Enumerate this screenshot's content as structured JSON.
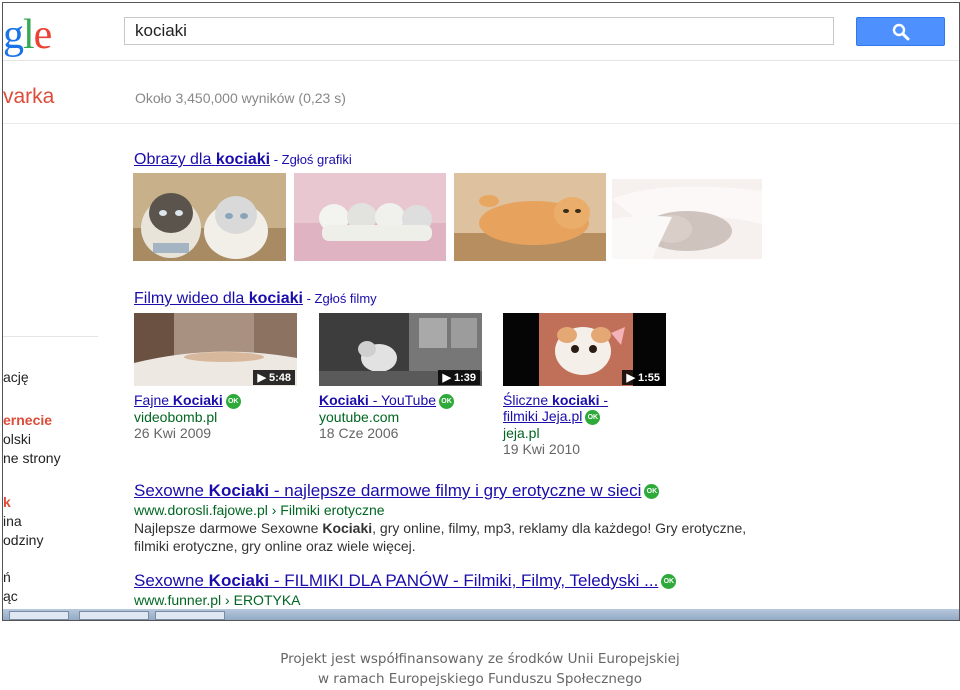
{
  "logo": {
    "visible_text": "gle",
    "colors": [
      "#1a73e8",
      "#34a853",
      "#ea4335"
    ]
  },
  "search": {
    "query": "kociaki",
    "button_icon": "magnifier-icon"
  },
  "left_title": "varka",
  "stats": "Około 3,450,000 wyników (0,23 s)",
  "sidebar": {
    "items": [
      {
        "label": "ację"
      },
      {
        "label": "ernecie"
      },
      {
        "label": "olski"
      },
      {
        "label": "ne strony"
      },
      {
        "label": "k"
      },
      {
        "label": "ina"
      },
      {
        "label": "odziny"
      },
      {
        "label": "ń"
      },
      {
        "label": "ąc"
      }
    ]
  },
  "images_section": {
    "head_prefix": "Obrazy dla ",
    "head_bold": "kociaki",
    "report_sep": " - ",
    "report": "Zgłoś grafiki"
  },
  "video_section": {
    "head_prefix": "Filmy wideo dla ",
    "head_bold": "kociaki",
    "report_sep": " - ",
    "report": "Zgłoś filmy",
    "videos": [
      {
        "duration": "▶ 5:48",
        "title_a": "Fajne ",
        "title_b": "Kociaki",
        "title_c": "",
        "title_line2": "",
        "site": "videobomb.pl",
        "date": "26 Kwi 2009",
        "ok": "OK"
      },
      {
        "duration": "▶ 1:39",
        "title_a": "",
        "title_b": "Kociaki",
        "title_c": " - YouTube",
        "title_line2": "",
        "site": "youtube.com",
        "date": "18 Cze 2006",
        "ok": "OK"
      },
      {
        "duration": "▶ 1:55",
        "title_a": "Śliczne ",
        "title_b": "kociaki",
        "title_c": " -",
        "title_line2": "filmiki Jeja.pl",
        "site": "jeja.pl",
        "date": "19 Kwi 2010",
        "ok": "OK"
      }
    ]
  },
  "results": [
    {
      "title_a": "Sexowne ",
      "title_b": "Kociaki",
      "title_c": " - najlepsze darmowe filmy i gry erotyczne w sieci",
      "ok": "OK",
      "url": "www.dorosli.fajowe.pl › Filmiki erotyczne",
      "snippet_a": "Najlepsze darmowe Sexowne ",
      "snippet_b": "Kociaki",
      "snippet_c": ", gry online, filmy, mp3, reklamy dla każdego! Gry erotyczne, filmiki erotyczne, gry online oraz wiele więcej."
    },
    {
      "title_a": "Sexowne ",
      "title_b": "Kociaki",
      "title_c": " - FILMIKI DLA PANÓW - Filmiki, Filmy, Teledyski ...",
      "ok": "OK",
      "url": "www.funner.pl › EROTYKA"
    }
  ],
  "footer": {
    "line1": "Projekt jest współfinansowany ze środków Unii Europejskiej",
    "line2": "w ramach Europejskiego Funduszu Społecznego"
  }
}
